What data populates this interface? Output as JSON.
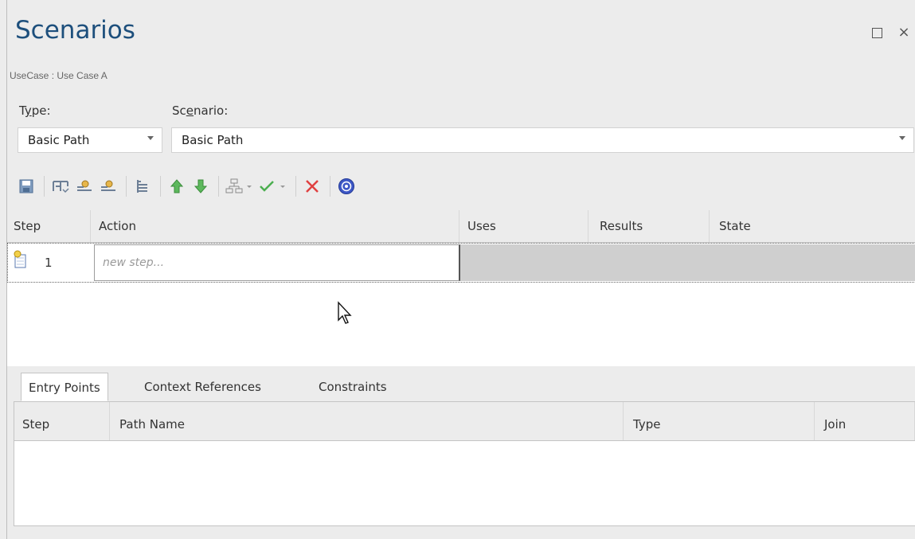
{
  "window": {
    "title": "Scenarios",
    "subtitle": "UseCase : Use Case A",
    "maximize_icon": "maximize-icon",
    "close_icon": "close-icon",
    "close_glyph": "×"
  },
  "form": {
    "type_label_pre": "T",
    "type_label_u": "y",
    "type_label_post": "pe:",
    "type_value": "Basic Path",
    "scenario_label_pre": "Sc",
    "scenario_label_u": "e",
    "scenario_label_post": "nario:",
    "scenario_value": "Basic Path"
  },
  "toolbar": {
    "icons": [
      "save-icon",
      "structured-steps-icon",
      "add-actor-icon",
      "add-element-icon",
      "indent-icon",
      "move-up-icon",
      "move-down-icon",
      "generate-diagram-icon",
      "validate-icon",
      "delete-icon",
      "help-icon"
    ]
  },
  "steps_grid": {
    "columns": [
      "Step",
      "Action",
      "Uses",
      "Results",
      "State"
    ],
    "rows": [
      {
        "step": "1",
        "action_placeholder": "new step..."
      }
    ]
  },
  "tabs": [
    "Entry Points",
    "Context References",
    "Constraints"
  ],
  "entry_grid": {
    "columns": [
      "Step",
      "Path Name",
      "Type",
      "Join"
    ]
  },
  "colors": {
    "title": "#1d4f7c",
    "background": "#ececec",
    "selected_row_fill": "#cfcfcf"
  }
}
